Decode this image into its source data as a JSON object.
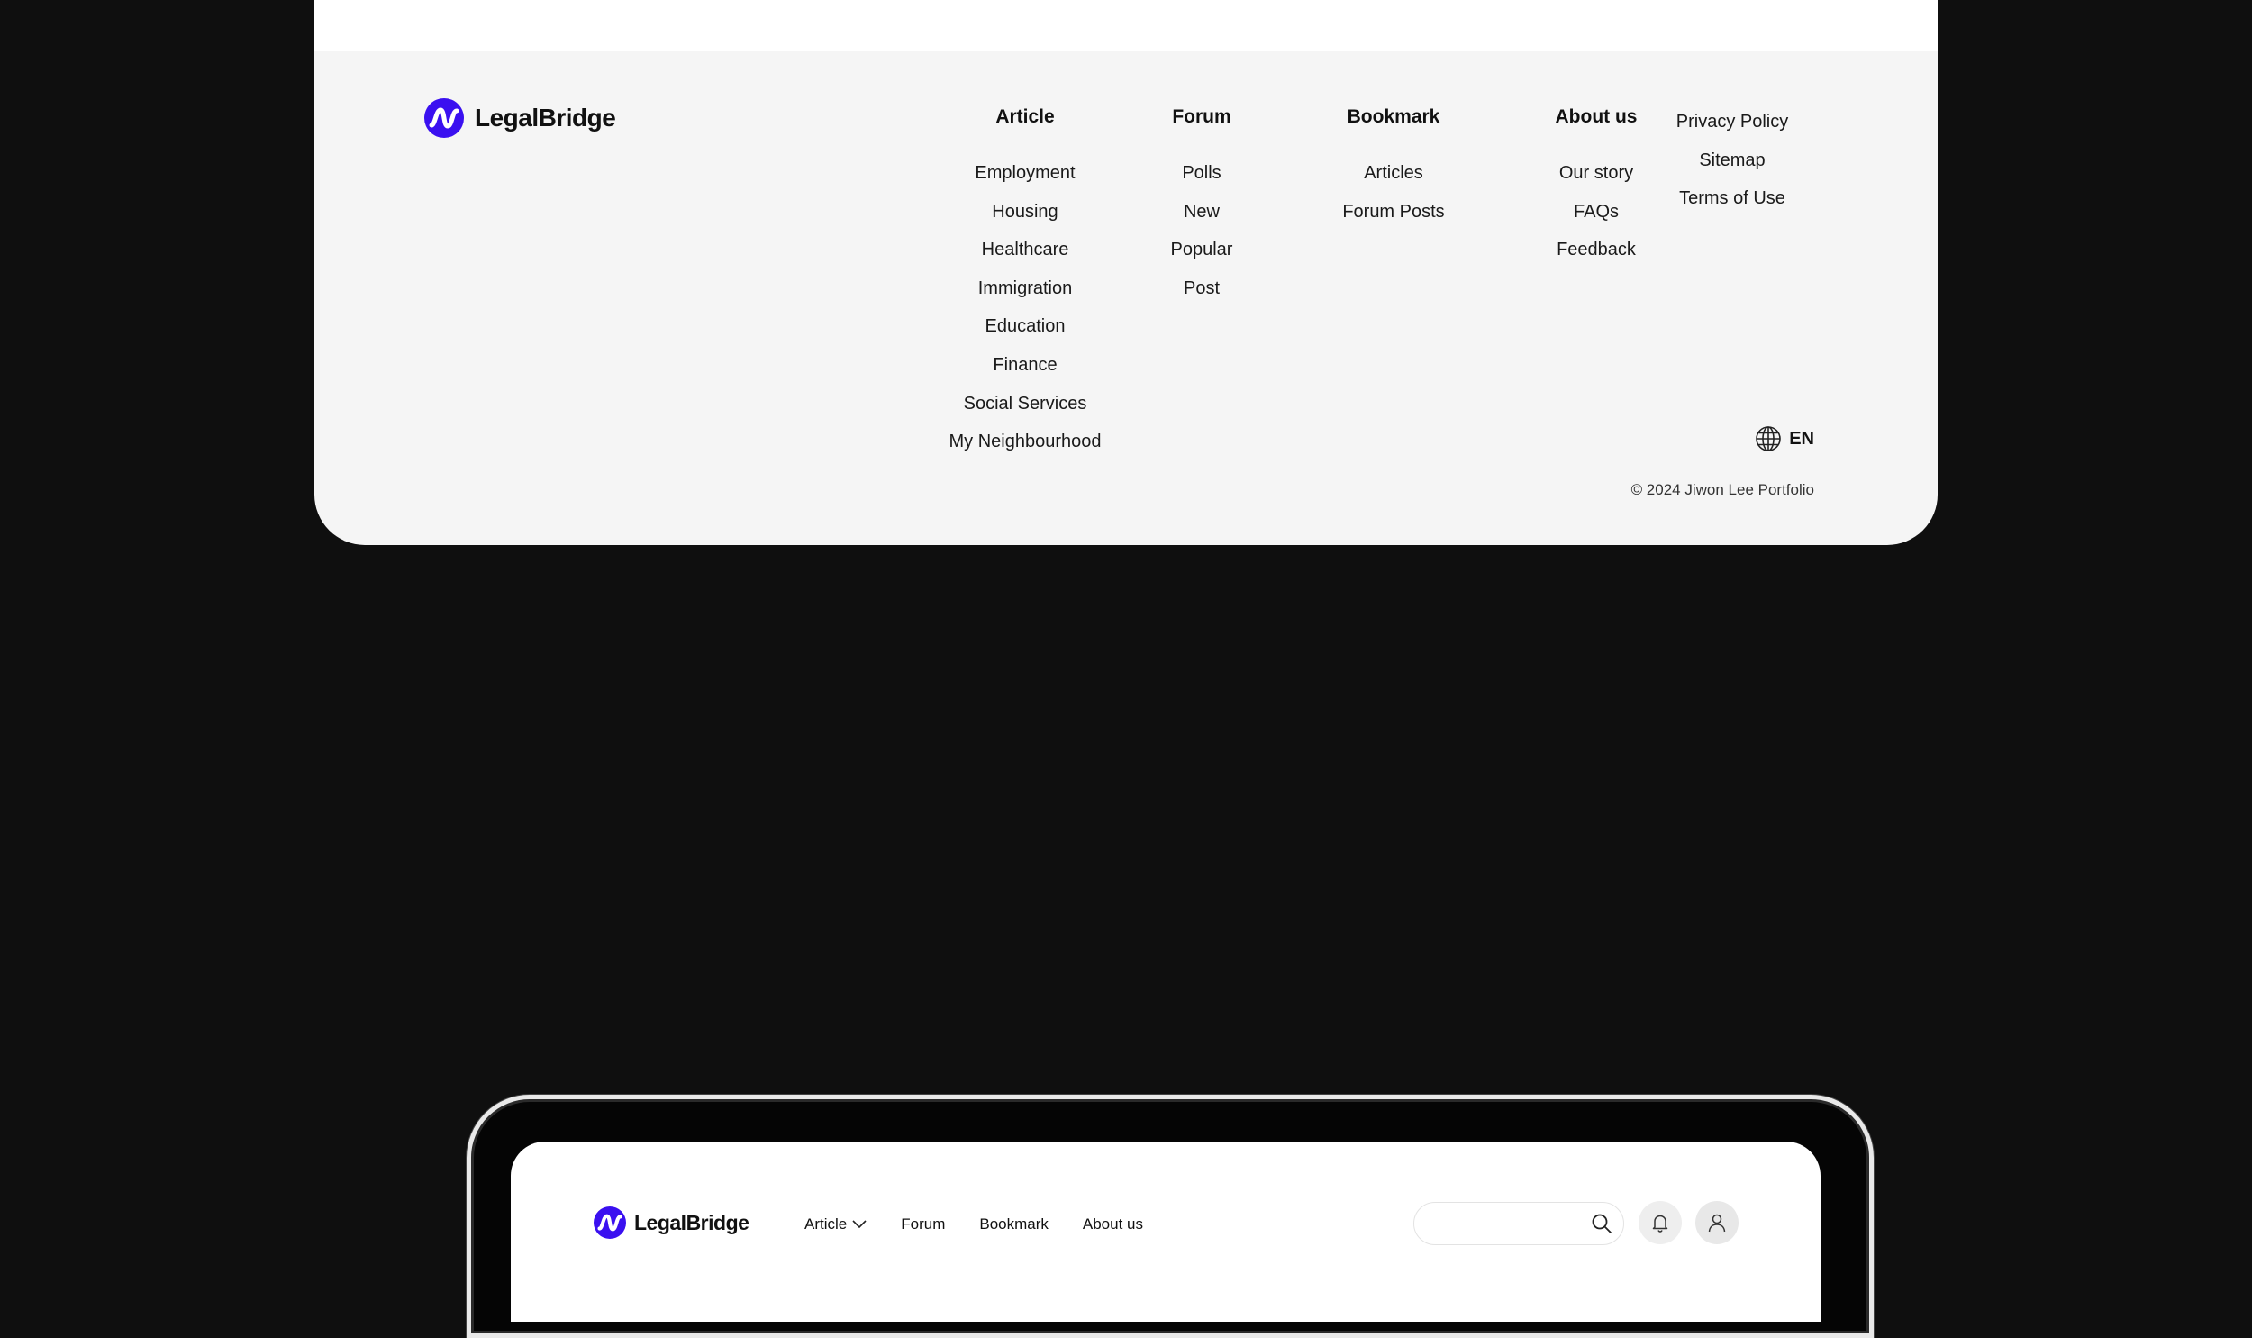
{
  "brand": {
    "name": "LegalBridge",
    "color": "#3a10f0",
    "icon": "logo-wave-icon"
  },
  "footer": {
    "columns": [
      {
        "title": "Article",
        "links": [
          "Employment",
          "Housing",
          "Healthcare",
          "Immigration",
          "Education",
          "Finance",
          "Social Services",
          "My Neighbourhood"
        ]
      },
      {
        "title": "Forum",
        "links": [
          "Polls",
          "New",
          "Popular",
          "Post"
        ]
      },
      {
        "title": "Bookmark",
        "links": [
          "Articles",
          "Forum Posts"
        ]
      },
      {
        "title": "About us",
        "links": [
          "Our story",
          "FAQs",
          "Feedback"
        ]
      }
    ],
    "legal_links": [
      "Privacy Policy",
      "Sitemap",
      "Terms of Use"
    ],
    "language": {
      "code": "EN",
      "icon": "globe-icon"
    },
    "copyright": "© 2024 Jiwon Lee Portfolio"
  },
  "header": {
    "nav": [
      {
        "label": "Article",
        "icon": "chevron-down-icon"
      },
      {
        "label": "Forum"
      },
      {
        "label": "Bookmark"
      },
      {
        "label": "About us"
      }
    ],
    "search": {
      "placeholder": "",
      "icon": "search-icon"
    },
    "notifications_icon": "bell-icon",
    "profile_icon": "user-icon"
  }
}
